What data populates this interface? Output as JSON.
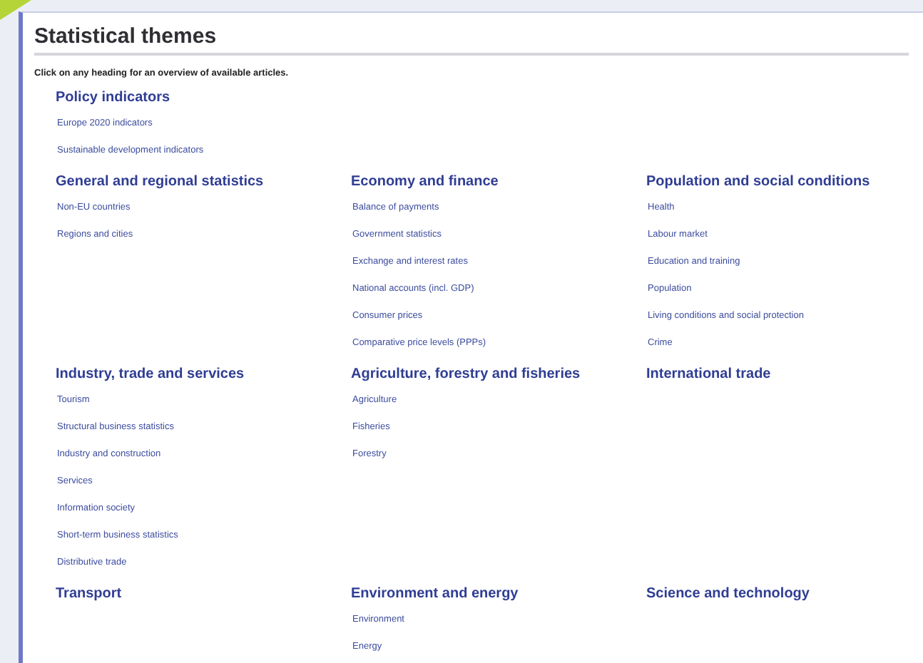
{
  "title": "Statistical themes",
  "instruction": "Click on any heading for an overview of available articles.",
  "rows": [
    [
      {
        "heading": "Policy indicators",
        "items": [
          "Europe 2020 indicators",
          "Sustainable development indicators"
        ]
      }
    ],
    [
      {
        "heading": "General and regional statistics",
        "items": [
          "Non-EU countries",
          "Regions and cities"
        ]
      },
      {
        "heading": "Economy and finance",
        "items": [
          "Balance of payments",
          "Government statistics",
          "Exchange and interest rates",
          "National accounts (incl. GDP)",
          "Consumer prices",
          "Comparative price levels (PPPs)"
        ]
      },
      {
        "heading": "Population and social conditions",
        "items": [
          "Health",
          "Labour market",
          "Education and training",
          "Population",
          "Living conditions and social protection",
          "Crime"
        ]
      }
    ],
    [
      {
        "heading": "Industry, trade and services",
        "items": [
          "Tourism",
          "Structural business statistics",
          "Industry and construction",
          "Services",
          "Information society",
          "Short-term business statistics",
          "Distributive trade"
        ]
      },
      {
        "heading": "Agriculture, forestry and fisheries",
        "items": [
          "Agriculture",
          "Fisheries",
          "Forestry"
        ]
      },
      {
        "heading": "International trade"
      }
    ],
    [
      {
        "heading": "Transport"
      },
      {
        "heading": "Environment and energy",
        "items": [
          "Environment",
          "Energy"
        ]
      },
      {
        "heading": "Science and technology"
      }
    ]
  ]
}
